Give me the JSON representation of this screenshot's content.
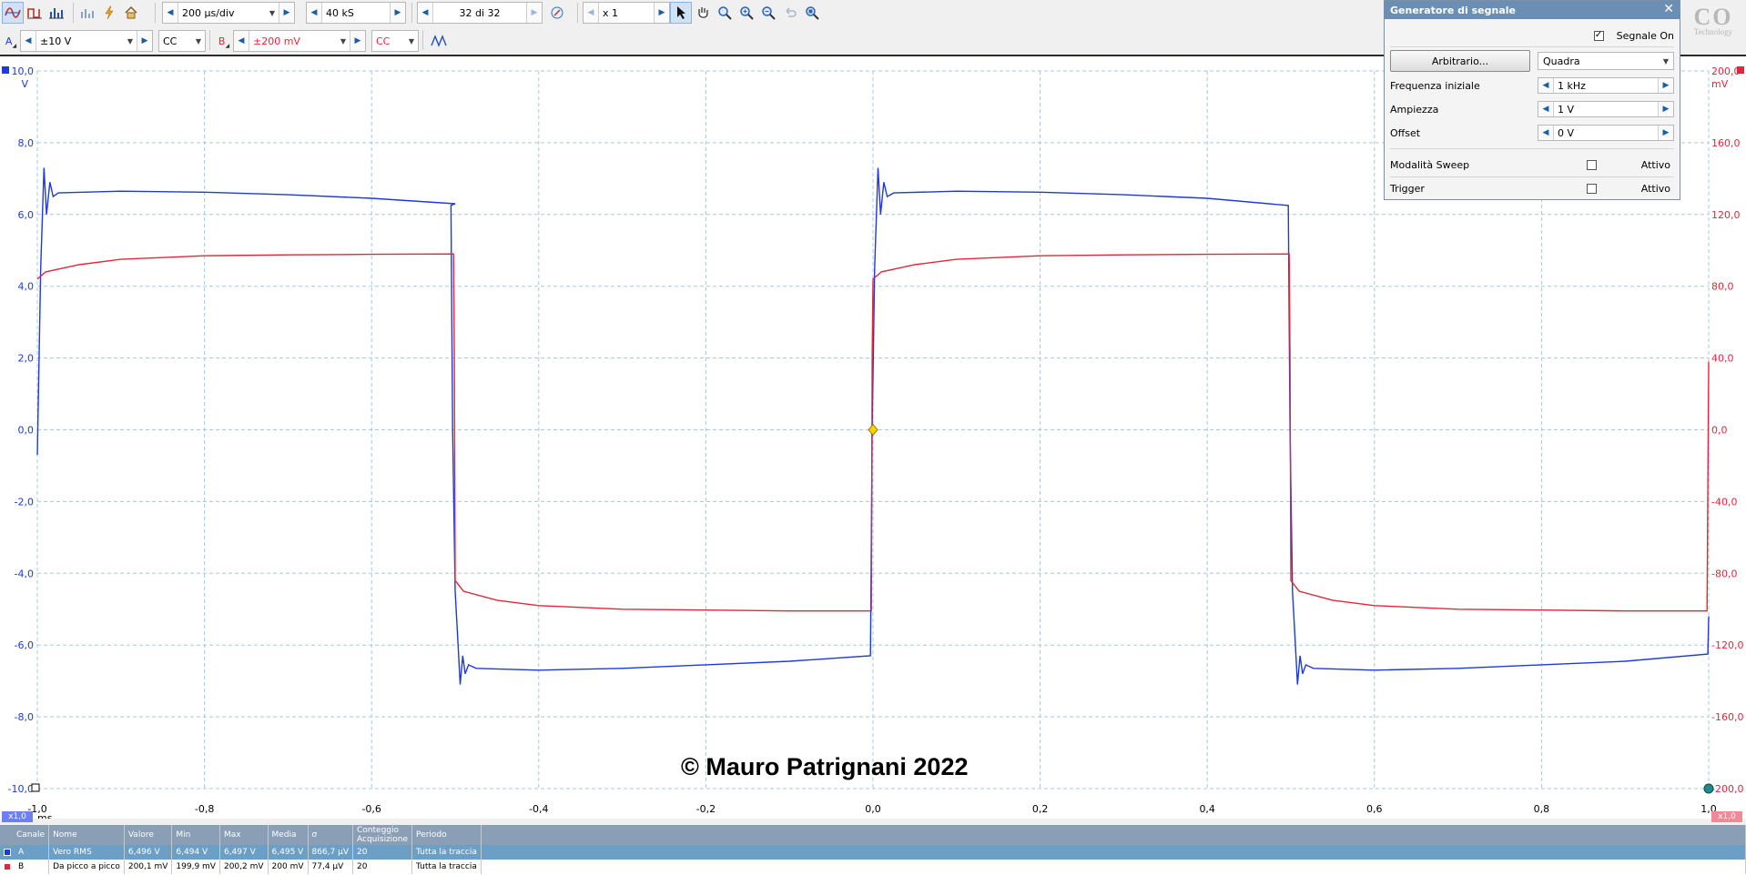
{
  "toolbar": {
    "timebase": "200 µs/div",
    "samples": "40 kS",
    "buffer": "32 di 32",
    "zoom": "x 1"
  },
  "channels": {
    "a": {
      "label": "A",
      "range": "±10 V",
      "coupling": "CC",
      "color": "#1f3ad6"
    },
    "b": {
      "label": "B",
      "range": "±200 mV",
      "coupling": "CC",
      "color": "#e0283c"
    }
  },
  "plot": {
    "left_unit": "V",
    "right_unit": "mV",
    "x_unit": "ms",
    "left_ticks": [
      "10,0",
      "8,0",
      "6,0",
      "4,0",
      "2,0",
      "0,0",
      "-2,0",
      "-4,0",
      "-6,0",
      "-8,0",
      "-10,0"
    ],
    "right_ticks": [
      "200,0",
      "160,0",
      "120,0",
      "80,0",
      "40,0",
      "0,0",
      "-40,0",
      "-80,0",
      "-120,0",
      "-160,0",
      "-200,0"
    ],
    "x_ticks": [
      "-1,0",
      "-0,8",
      "-0,6",
      "-0,4",
      "-0,2",
      "0,0",
      "0,2",
      "0,4",
      "0,6",
      "0,8",
      "1,0"
    ],
    "x_zoom_left": "x1,0",
    "x_zoom_right": "x1,0",
    "watermark": "© Mauro Patrignani 2022",
    "logo": "PICO Technology"
  },
  "chart_data": {
    "type": "line",
    "x_label": "ms",
    "xlim": [
      -1.0,
      1.0
    ],
    "series": [
      {
        "name": "A",
        "axis": "left",
        "unit": "V",
        "ylim": [
          -10,
          10
        ],
        "color": "#1f3ad6",
        "points": [
          [
            -1.0,
            -0.7
          ],
          [
            -0.996,
            4.5
          ],
          [
            -0.992,
            7.3
          ],
          [
            -0.989,
            6.0
          ],
          [
            -0.985,
            6.9
          ],
          [
            -0.981,
            6.5
          ],
          [
            -0.975,
            6.6
          ],
          [
            -0.9,
            6.65
          ],
          [
            -0.8,
            6.62
          ],
          [
            -0.7,
            6.55
          ],
          [
            -0.6,
            6.45
          ],
          [
            -0.5,
            6.3
          ],
          [
            -0.505,
            6.25
          ],
          [
            -0.503,
            0
          ],
          [
            -0.5,
            -4.5
          ],
          [
            -0.497,
            -5.8
          ],
          [
            -0.494,
            -7.1
          ],
          [
            -0.491,
            -6.3
          ],
          [
            -0.488,
            -6.8
          ],
          [
            -0.484,
            -6.55
          ],
          [
            -0.475,
            -6.65
          ],
          [
            -0.4,
            -6.7
          ],
          [
            -0.3,
            -6.65
          ],
          [
            -0.2,
            -6.55
          ],
          [
            -0.1,
            -6.45
          ],
          [
            -0.003,
            -6.3
          ],
          [
            -0.001,
            0
          ],
          [
            0.002,
            4.5
          ],
          [
            0.006,
            7.3
          ],
          [
            0.009,
            6.0
          ],
          [
            0.013,
            6.9
          ],
          [
            0.017,
            6.5
          ],
          [
            0.025,
            6.6
          ],
          [
            0.1,
            6.65
          ],
          [
            0.2,
            6.62
          ],
          [
            0.3,
            6.55
          ],
          [
            0.4,
            6.45
          ],
          [
            0.497,
            6.25
          ],
          [
            0.499,
            0
          ],
          [
            0.502,
            -4.5
          ],
          [
            0.505,
            -5.8
          ],
          [
            0.508,
            -7.1
          ],
          [
            0.511,
            -6.3
          ],
          [
            0.514,
            -6.8
          ],
          [
            0.518,
            -6.55
          ],
          [
            0.527,
            -6.65
          ],
          [
            0.6,
            -6.7
          ],
          [
            0.7,
            -6.65
          ],
          [
            0.8,
            -6.55
          ],
          [
            0.9,
            -6.45
          ],
          [
            0.999,
            -6.25
          ],
          [
            1.0,
            -5.2
          ]
        ]
      },
      {
        "name": "B",
        "axis": "right",
        "unit": "mV",
        "ylim": [
          -200,
          200
        ],
        "color": "#e0283c",
        "points": [
          [
            -1.0,
            84
          ],
          [
            -0.99,
            88
          ],
          [
            -0.95,
            92
          ],
          [
            -0.9,
            95
          ],
          [
            -0.8,
            97
          ],
          [
            -0.7,
            97.5
          ],
          [
            -0.6,
            97.8
          ],
          [
            -0.502,
            98
          ],
          [
            -0.501,
            40
          ],
          [
            -0.5,
            -84
          ],
          [
            -0.49,
            -90
          ],
          [
            -0.45,
            -95
          ],
          [
            -0.4,
            -98
          ],
          [
            -0.3,
            -100
          ],
          [
            -0.2,
            -100.5
          ],
          [
            -0.1,
            -101
          ],
          [
            -0.002,
            -101
          ],
          [
            -0.001,
            40
          ],
          [
            0.0,
            84
          ],
          [
            0.01,
            88
          ],
          [
            0.05,
            92
          ],
          [
            0.1,
            95
          ],
          [
            0.2,
            97
          ],
          [
            0.3,
            97.5
          ],
          [
            0.4,
            97.8
          ],
          [
            0.498,
            98
          ],
          [
            0.499,
            40
          ],
          [
            0.5,
            -84
          ],
          [
            0.51,
            -90
          ],
          [
            0.55,
            -95
          ],
          [
            0.6,
            -98
          ],
          [
            0.7,
            -100
          ],
          [
            0.8,
            -100.5
          ],
          [
            0.9,
            -101
          ],
          [
            0.998,
            -101
          ],
          [
            1.0,
            38
          ]
        ]
      }
    ]
  },
  "measurements": {
    "headers": [
      "Canale",
      "Nome",
      "Valore",
      "Min",
      "Max",
      "Media",
      "σ",
      "Conteggio Acquisizione",
      "Periodo"
    ],
    "rows": [
      [
        "A",
        "Vero RMS",
        "6,496 V",
        "6,494 V",
        "6,497 V",
        "6,495 V",
        "866,7 µV",
        "20",
        "Tutta la traccia"
      ],
      [
        "B",
        "Da picco a picco",
        "200,1 mV",
        "199,9 mV",
        "200,2 mV",
        "200 mV",
        "77,4 µV",
        "20",
        "Tutta la traccia"
      ]
    ]
  },
  "siggen": {
    "title": "Generatore di segnale",
    "on_label": "Segnale On",
    "on_checked": true,
    "arb_button": "Arbitrario...",
    "waveform": "Quadra",
    "freq_label": "Frequenza iniziale",
    "freq": "1 kHz",
    "amp_label": "Ampiezza",
    "amp": "1 V",
    "offset_label": "Offset",
    "offset": "0 V",
    "sweep_label": "Modalità Sweep",
    "sweep_state": "Attivo",
    "trigger_label": "Trigger",
    "trigger_state": "Attivo"
  }
}
